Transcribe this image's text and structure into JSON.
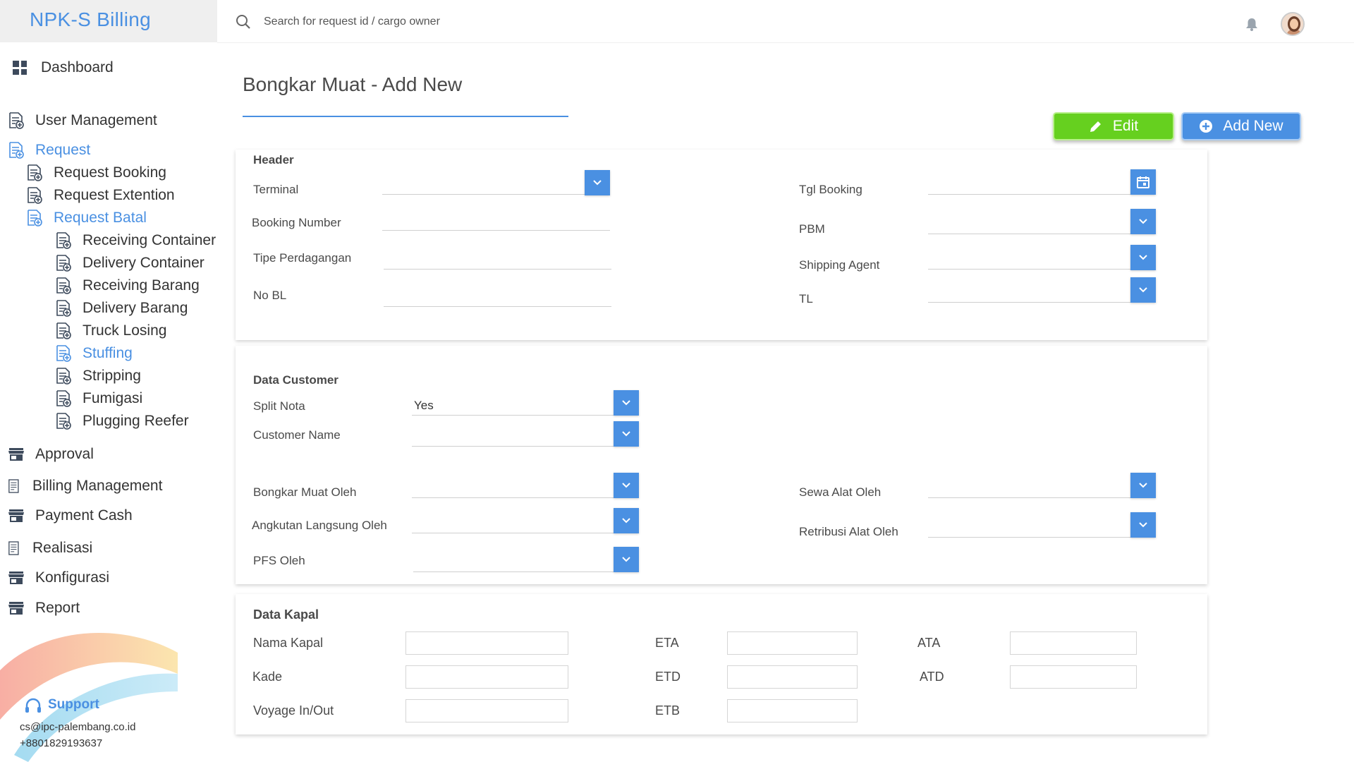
{
  "app": {
    "brand": "NPK-S Billing"
  },
  "search": {
    "placeholder": "Search for request id / cargo owner"
  },
  "sidebar": {
    "dashboard": "Dashboard",
    "user_management": "User Management",
    "request": "Request",
    "request_booking": "Request Booking",
    "request_extention": "Request Extention",
    "request_batal": "Request Batal",
    "sub": [
      "Receiving Container",
      "Delivery Container",
      "Receiving Barang",
      "Delivery Barang",
      "Truck Losing",
      "Stuffing",
      "Stripping",
      "Fumigasi",
      "Plugging Reefer"
    ],
    "approval": "Approval",
    "billing_management": "Billing Management",
    "payment_cash": "Payment Cash",
    "realisasi": "Realisasi",
    "konfigurasi": "Konfigurasi",
    "report": "Report"
  },
  "support": {
    "title": "Support",
    "email": "cs@ipc-palembang.co.id",
    "phone": "+8801829193637"
  },
  "page": {
    "title": "Bongkar Muat - Add New"
  },
  "buttons": {
    "edit": "Edit",
    "add_new": "Add New"
  },
  "header_section": {
    "title": "Header",
    "terminal": "Terminal",
    "booking_number": "Booking Number",
    "tipe_perdagangan": "Tipe Perdagangan",
    "no_bl": "No BL",
    "tgl_booking": "Tgl Booking",
    "pbm": "PBM",
    "shipping_agent": "Shipping Agent",
    "tl": "TL"
  },
  "customer_section": {
    "title": "Data Customer",
    "split_nota": "Split Nota",
    "split_nota_value": "Yes",
    "customer_name": "Customer Name",
    "bongkar_muat_oleh": "Bongkar Muat Oleh",
    "angkutan_langsung_oleh": "Angkutan Langsung Oleh",
    "pfs_oleh": "PFS Oleh",
    "sewa_alat_oleh": "Sewa Alat Oleh",
    "retribusi_alat_oleh": "Retribusi Alat Oleh"
  },
  "kapal_section": {
    "title": "Data Kapal",
    "nama_kapal": "Nama Kapal",
    "kade": "Kade",
    "voyage": "Voyage In/Out",
    "eta": "ETA",
    "etd": "ETD",
    "etb": "ETB",
    "ata": "ATA",
    "atd": "ATD"
  },
  "colors": {
    "accent": "#4a90e2",
    "edit": "#66d01f"
  }
}
